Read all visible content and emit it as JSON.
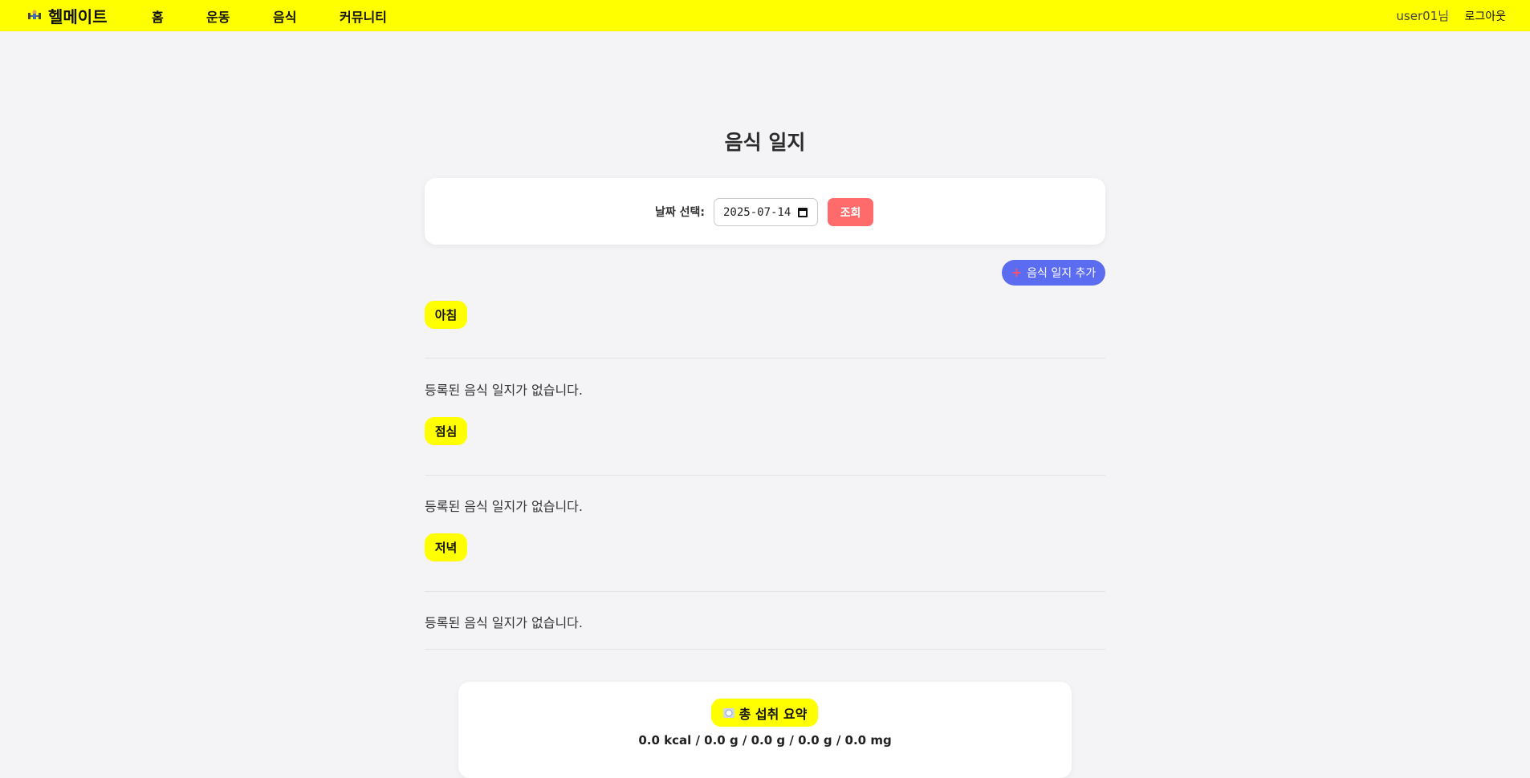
{
  "app": {
    "brand": "헬메이트",
    "brand_icon": "dumbbell-icon",
    "nav": [
      {
        "label": "홈"
      },
      {
        "label": "운동"
      },
      {
        "label": "음식"
      },
      {
        "label": "커뮤니티"
      }
    ],
    "user": "user01님",
    "logout": "로그아웃"
  },
  "page": {
    "title": "음식 일지",
    "date_label": "날짜 선택:",
    "date_value": "2025-07-14",
    "search_button": "조회",
    "add_button": "음식 일지 추가",
    "add_icon": "plus-icon"
  },
  "meals": [
    {
      "name": "아침",
      "empty_text": "등록된 음식 일지가 없습니다."
    },
    {
      "name": "점심",
      "empty_text": "등록된 음식 일지가 없습니다."
    },
    {
      "name": "저녁",
      "empty_text": "등록된 음식 일지가 없습니다."
    }
  ],
  "summary": {
    "title": "총 섭취 요약",
    "icon": "plate-icon",
    "values": "0.0 kcal / 0.0 g / 0.0 g / 0.0 g / 0.0 mg"
  },
  "colors": {
    "header": "#ffff00",
    "accent_red": "#ff6b6b",
    "accent_blue": "#5b6cf0",
    "background": "#f4f3f6"
  }
}
